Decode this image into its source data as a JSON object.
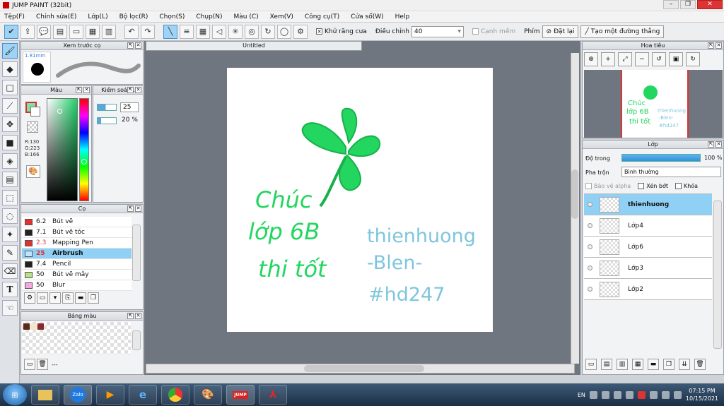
{
  "window": {
    "title": "JUMP PAINT (32bit)"
  },
  "menu": [
    "Tệp(F)",
    "Chỉnh sửa(E)",
    "Lớp(L)",
    "Bộ lọc(R)",
    "Chọn(S)",
    "Chụp(N)",
    "Màu (C)",
    "Xem(V)",
    "Công cụ(T)",
    "Cửa sổ(W)",
    "Help"
  ],
  "toolbar": {
    "antialias_label": "Khử răng cưa",
    "adjust_label": "Điều chỉnh",
    "adjust_value": "40",
    "edge_label": "Cạnh mềm",
    "key_label": "Phím",
    "reset_label": "Đặt lại",
    "straight_label": "Tạo một đường thẳng"
  },
  "brush_preview": {
    "title": "Xem trước cọ",
    "size": "1.81mm"
  },
  "color_panel": {
    "title": "Màu",
    "r": "R:130",
    "g": "G:223",
    "b": "B:166",
    "main_color": "#82dfa6"
  },
  "control_panel": {
    "title": "Kiểm soát...",
    "value1": "25",
    "value2": "20 %"
  },
  "brush_panel": {
    "title": "Cọ",
    "items": [
      {
        "size": "6.2",
        "name": "Bút vẽ",
        "color": "#e03030"
      },
      {
        "size": "7.1",
        "name": "Bút vẽ tóc",
        "color": "#222222"
      },
      {
        "size": "2.3",
        "name": "Mapping Pen",
        "color": "#e03030"
      },
      {
        "size": "25",
        "name": "Airbrush",
        "color": "#bfe6ff"
      },
      {
        "size": "7.4",
        "name": "Pencil",
        "color": "#222222"
      },
      {
        "size": "50",
        "name": "Bút vẽ mây",
        "color": "#b8e08a"
      },
      {
        "size": "50",
        "name": "Blur",
        "color": "#f4a8e0"
      }
    ]
  },
  "palette_panel": {
    "title": "Bảng màu",
    "footer": "---"
  },
  "document": {
    "tab": "Untitled"
  },
  "artwork": {
    "line1": "Chúc",
    "line2": "lớp 6B",
    "line3": "thi tốt",
    "name1": "thienhuong",
    "name2": "-Blen-",
    "name3": "#hd247",
    "green": "#22d65f",
    "blue": "#7ec6dc"
  },
  "navigator": {
    "title": "Hoa tiêu"
  },
  "layer_panel": {
    "title": "Lớp",
    "opacity_label": "Độ trong",
    "opacity_value": "100 %",
    "blend_label": "Pha trộn",
    "blend_value": "Bình thường",
    "alpha_label": "Bảo vệ alpha",
    "clip_label": "Xén bớt",
    "lock_label": "Khóa",
    "layers": [
      {
        "name": "thienhuong",
        "selected": true
      },
      {
        "name": "Lớp4",
        "selected": false
      },
      {
        "name": "Lớp6",
        "selected": false
      },
      {
        "name": "Lớp3",
        "selected": false
      },
      {
        "name": "Lớp2",
        "selected": false
      }
    ]
  },
  "taskbar": {
    "apps": [
      "Zalo",
      "Media",
      "IE",
      "Chrome",
      "Paint",
      "Jump Paint",
      "PDF"
    ],
    "lang": "EN",
    "time": "07:15 PM",
    "date": "10/15/2021"
  }
}
